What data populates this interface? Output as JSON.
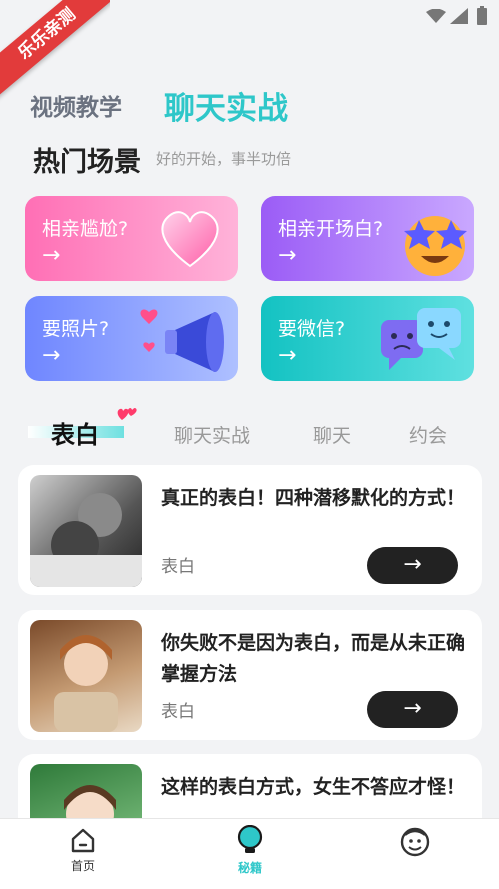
{
  "badge": "乐乐亲测",
  "top_tabs": [
    {
      "label": "视频教学",
      "active": false
    },
    {
      "label": "聊天实战",
      "active": true
    }
  ],
  "section": {
    "title": "热门场景",
    "subtitle": "好的开始，事半功倍"
  },
  "scenes": [
    {
      "label": "相亲尴尬?",
      "arrow": "→",
      "icon": "heart-icon"
    },
    {
      "label": "相亲开场白?",
      "arrow": "→",
      "icon": "star-eyes-emoji-icon"
    },
    {
      "label": "要照片?",
      "arrow": "→",
      "icon": "megaphone-icon"
    },
    {
      "label": "要微信?",
      "arrow": "→",
      "icon": "chat-bubbles-icon"
    }
  ],
  "categories": [
    {
      "label": "表白",
      "active": true
    },
    {
      "label": "聊天实战",
      "active": false
    },
    {
      "label": "聊天",
      "active": false
    },
    {
      "label": "约会",
      "active": false
    }
  ],
  "articles": [
    {
      "title": "真正的表白！四种潜移默化的方式！",
      "tag": "表白",
      "button": "→"
    },
    {
      "title": "你失败不是因为表白，而是从未正确掌握方法",
      "tag": "表白",
      "button": "→"
    },
    {
      "title": "这样的表白方式，女生不答应才怪！",
      "tag": "",
      "button": ""
    }
  ],
  "nav": [
    {
      "label": "首页",
      "icon": "home-icon",
      "active": false
    },
    {
      "label": "秘籍",
      "icon": "lightbulb-icon",
      "active": true
    },
    {
      "label": "",
      "icon": "profile-icon",
      "active": false
    }
  ],
  "colors": {
    "accent": "#2ec7c9",
    "badge": "#e23b3b",
    "dark_button": "#222222",
    "background": "#f2f3f5"
  }
}
